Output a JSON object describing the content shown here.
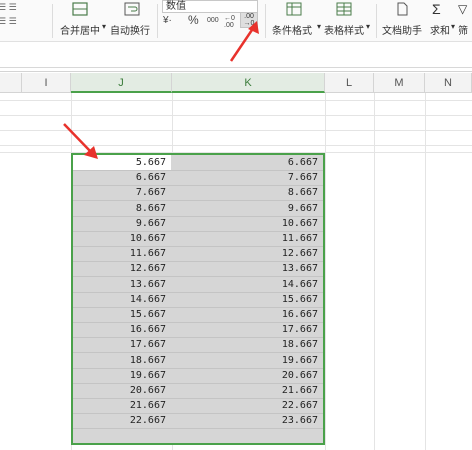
{
  "ribbon": {
    "merge_center_label": "合并居中",
    "wrap_text_label": "自动换行",
    "number_format_value": "数值",
    "percent_symbol": "%",
    "thousands_symbol": "000",
    "increase_decimal_symbol": ".0→.00",
    "decrease_decimal_symbol": ".00→.0",
    "conditional_format_label": "条件格式",
    "table_style_label": "表格样式",
    "doc_helper_label": "文档助手",
    "sum_label": "求和",
    "filter_label": "筛"
  },
  "columns": [
    "I",
    "J",
    "K",
    "L",
    "M",
    "N"
  ],
  "column_j_values": [
    "5.667",
    "6.667",
    "7.667",
    "8.667",
    "9.667",
    "10.667",
    "11.667",
    "12.667",
    "13.667",
    "14.667",
    "15.667",
    "16.667",
    "17.667",
    "18.667",
    "19.667",
    "20.667",
    "21.667",
    "22.667"
  ],
  "column_k_values": [
    "6.667",
    "7.667",
    "8.667",
    "9.667",
    "10.667",
    "11.667",
    "12.667",
    "13.667",
    "14.667",
    "15.667",
    "16.667",
    "17.667",
    "18.667",
    "19.667",
    "20.667",
    "21.667",
    "22.667",
    "23.667"
  ],
  "colors": {
    "selection_border": "#4aa14a",
    "annotation_arrow": "#e8322c",
    "selection_fill": "#d6d6d6"
  }
}
